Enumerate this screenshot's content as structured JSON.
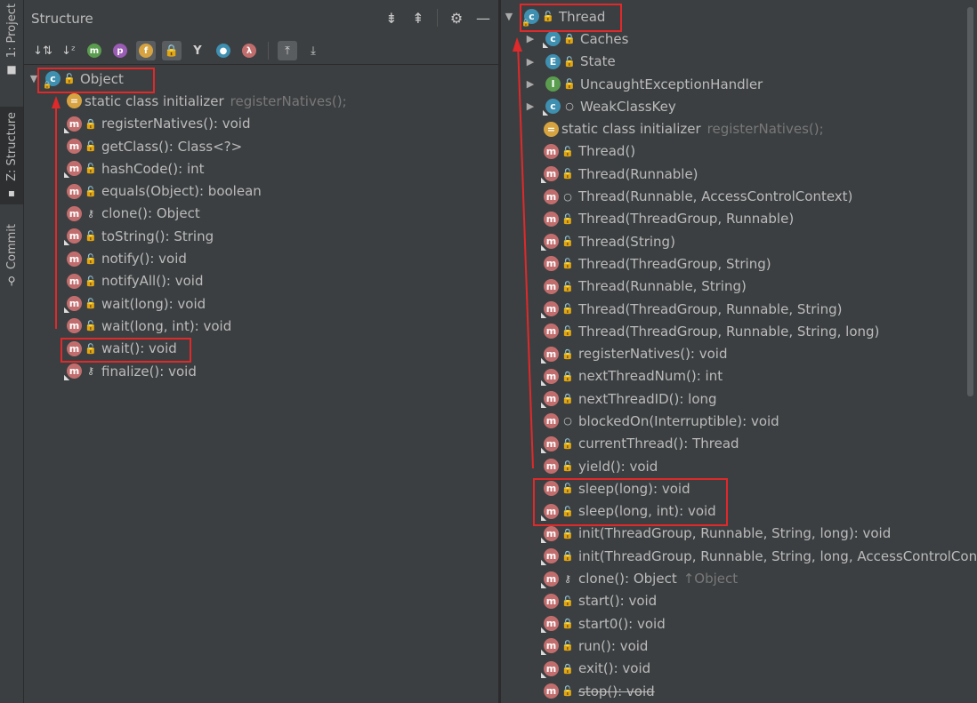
{
  "side_tabs": [
    {
      "label": "1: Project",
      "icon": "folder-icon"
    },
    {
      "label": "Z: Structure",
      "icon": "structure-icon"
    },
    {
      "label": "Commit",
      "icon": "commit-icon"
    }
  ],
  "structure_panel": {
    "title": "Structure",
    "header_icons": [
      "expand-all-icon",
      "collapse-all-icon",
      "gear-icon",
      "minimize-icon"
    ],
    "toolbar": [
      {
        "name": "sort-by-visibility-icon",
        "glyph": "↓⇅"
      },
      {
        "name": "sort-alphabetically-icon",
        "glyph": "↓a"
      },
      {
        "name": "show-inherited-icon",
        "glyph": "m"
      },
      {
        "name": "show-properties-icon",
        "glyph": "p"
      },
      {
        "name": "show-fields-icon",
        "glyph": "f"
      },
      {
        "name": "show-non-public-icon",
        "glyph": "🔒"
      },
      {
        "name": "show-anonymous-icon",
        "glyph": "Y"
      },
      {
        "name": "show-inner-classes-icon",
        "glyph": "○"
      },
      {
        "name": "show-lambdas-icon",
        "glyph": "λ"
      },
      {
        "name": "autoscroll-to-source-icon",
        "glyph": "⤒"
      },
      {
        "name": "autoscroll-from-source-icon",
        "glyph": "⤓"
      }
    ]
  },
  "colors": {
    "highlight": "#e0292a",
    "method_icon": "#c26d6d",
    "class_icon": "#3e8fb0",
    "public": "#62b543",
    "private": "#d96a4a"
  },
  "left_tree": {
    "root": "Object",
    "items": [
      {
        "kind": "s",
        "vis": "none",
        "label": "static class initializer",
        "hint": "registerNatives();"
      },
      {
        "kind": "m",
        "vis": "priv",
        "label": "registerNatives(): void"
      },
      {
        "kind": "m",
        "vis": "pub",
        "label": "getClass(): Class<?>"
      },
      {
        "kind": "m",
        "vis": "pub",
        "label": "hashCode(): int"
      },
      {
        "kind": "m",
        "vis": "pub",
        "label": "equals(Object): boolean"
      },
      {
        "kind": "m",
        "vis": "prot",
        "label": "clone(): Object"
      },
      {
        "kind": "m",
        "vis": "pub",
        "label": "toString(): String"
      },
      {
        "kind": "m",
        "vis": "pub",
        "label": "notify(): void"
      },
      {
        "kind": "m",
        "vis": "pub",
        "label": "notifyAll(): void"
      },
      {
        "kind": "m",
        "vis": "pub",
        "label": "wait(long): void"
      },
      {
        "kind": "m",
        "vis": "pub",
        "label": "wait(long, int): void"
      },
      {
        "kind": "m",
        "vis": "pub",
        "label": "wait(): void"
      },
      {
        "kind": "m",
        "vis": "prot",
        "label": "finalize(): void"
      }
    ]
  },
  "right_tree": {
    "root": "Thread",
    "items": [
      {
        "kind": "c",
        "vis": "priv",
        "label": "Caches",
        "arrow": true
      },
      {
        "kind": "e",
        "vis": "pub",
        "label": "State",
        "arrow": true
      },
      {
        "kind": "i",
        "vis": "pub",
        "label": "UncaughtExceptionHandler",
        "arrow": true
      },
      {
        "kind": "c",
        "vis": "pkg",
        "label": "WeakClassKey",
        "arrow": true
      },
      {
        "kind": "s",
        "vis": "none",
        "label": "static class initializer",
        "hint": "registerNatives();"
      },
      {
        "kind": "m",
        "vis": "pub",
        "label": "Thread()"
      },
      {
        "kind": "m",
        "vis": "pub",
        "label": "Thread(Runnable)"
      },
      {
        "kind": "m",
        "vis": "pkg",
        "label": "Thread(Runnable, AccessControlContext)"
      },
      {
        "kind": "m",
        "vis": "pub",
        "label": "Thread(ThreadGroup, Runnable)"
      },
      {
        "kind": "m",
        "vis": "pub",
        "label": "Thread(String)"
      },
      {
        "kind": "m",
        "vis": "pub",
        "label": "Thread(ThreadGroup, String)"
      },
      {
        "kind": "m",
        "vis": "pub",
        "label": "Thread(Runnable, String)"
      },
      {
        "kind": "m",
        "vis": "pub",
        "label": "Thread(ThreadGroup, Runnable, String)"
      },
      {
        "kind": "m",
        "vis": "pub",
        "label": "Thread(ThreadGroup, Runnable, String, long)"
      },
      {
        "kind": "m",
        "vis": "priv",
        "label": "registerNatives(): void"
      },
      {
        "kind": "m",
        "vis": "priv",
        "label": "nextThreadNum(): int"
      },
      {
        "kind": "m",
        "vis": "priv",
        "label": "nextThreadID(): long"
      },
      {
        "kind": "m",
        "vis": "pkg",
        "label": "blockedOn(Interruptible): void"
      },
      {
        "kind": "m",
        "vis": "pub",
        "label": "currentThread(): Thread"
      },
      {
        "kind": "m",
        "vis": "pub",
        "label": "yield(): void"
      },
      {
        "kind": "m",
        "vis": "pub",
        "label": "sleep(long): void"
      },
      {
        "kind": "m",
        "vis": "pub",
        "label": "sleep(long, int): void"
      },
      {
        "kind": "m",
        "vis": "priv",
        "label": "init(ThreadGroup, Runnable, String, long): void"
      },
      {
        "kind": "m",
        "vis": "priv",
        "label": "init(ThreadGroup, Runnable, String, long, AccessControlContext, boolean): void"
      },
      {
        "kind": "m",
        "vis": "prot",
        "label": "clone(): Object",
        "hint": "↑Object"
      },
      {
        "kind": "m",
        "vis": "pub",
        "label": "start(): void"
      },
      {
        "kind": "m",
        "vis": "priv",
        "label": "start0(): void"
      },
      {
        "kind": "m",
        "vis": "pub",
        "label": "run(): void"
      },
      {
        "kind": "m",
        "vis": "priv",
        "label": "exit(): void"
      },
      {
        "kind": "m",
        "vis": "pub",
        "label": "stop(): void",
        "deprecated": true
      }
    ]
  }
}
